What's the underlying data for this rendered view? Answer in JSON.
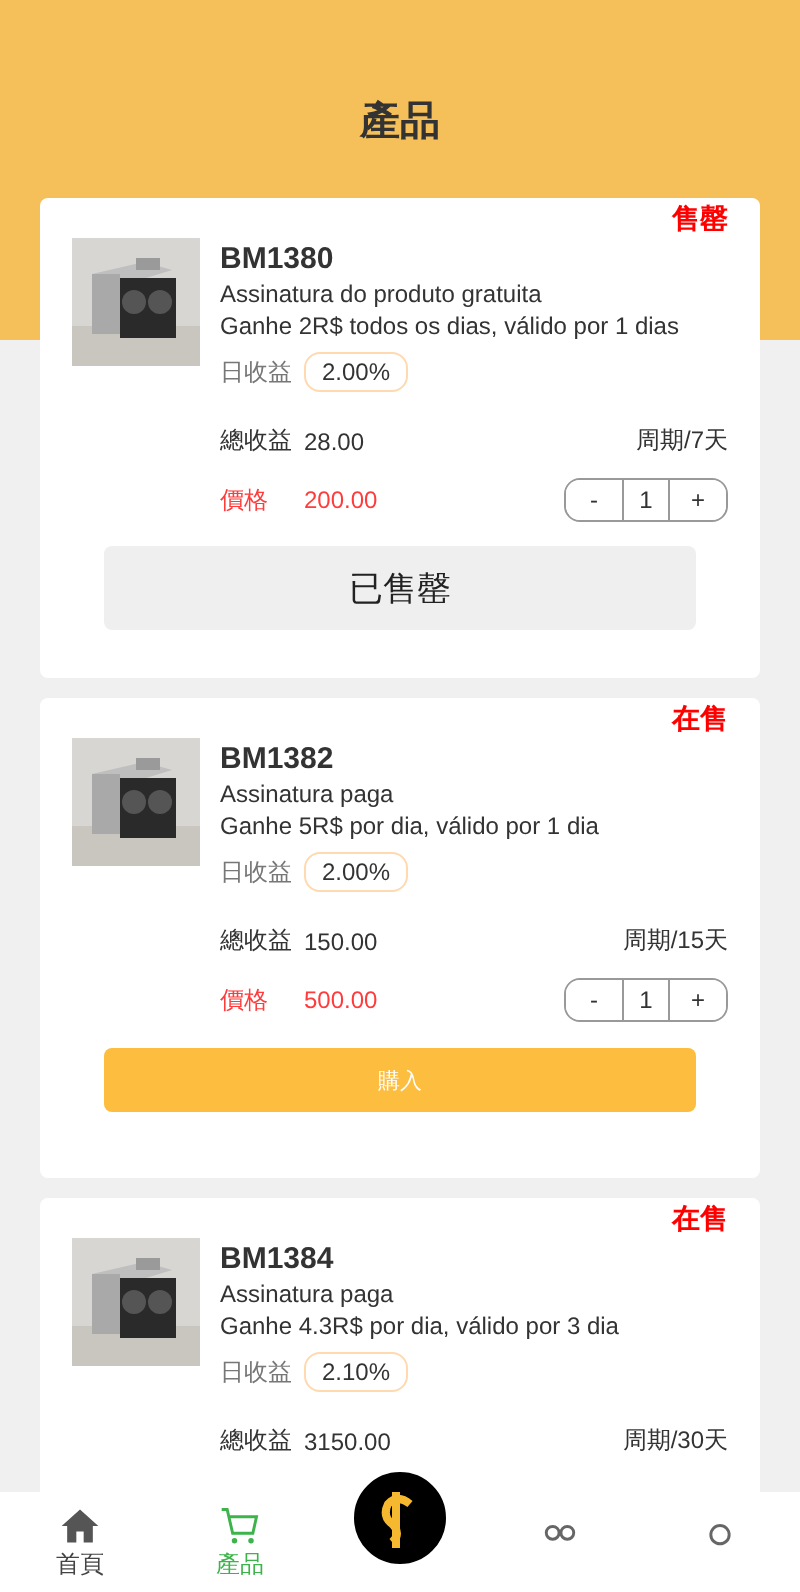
{
  "header": {
    "title": "產品"
  },
  "products": [
    {
      "status": "售罄",
      "name": "BM1380",
      "subscription": "Assinatura do produto gratuita",
      "description": "Ganhe 2R$ todos os dias, válido por 1 dias",
      "rate_label": "日收益",
      "rate": "2.00%",
      "total_label": "總收益",
      "total": "28.00",
      "period": "周期/7天",
      "price_label": "價格",
      "price": "200.00",
      "quantity": {
        "minus": "-",
        "value": "1",
        "plus": "+"
      },
      "button": {
        "kind": "sold_out",
        "label": "已售罄"
      }
    },
    {
      "status": "在售",
      "name": "BM1382",
      "subscription": "Assinatura paga",
      "description": "Ganhe 5R$ por dia, válido por 1 dia",
      "rate_label": "日收益",
      "rate": "2.00%",
      "total_label": "總收益",
      "total": "150.00",
      "period": "周期/15天",
      "price_label": "價格",
      "price": "500.00",
      "quantity": {
        "minus": "-",
        "value": "1",
        "plus": "+"
      },
      "button": {
        "kind": "buy",
        "label": "購入"
      }
    },
    {
      "status": "在售",
      "name": "BM1384",
      "subscription": "Assinatura paga",
      "description": "Ganhe 4.3R$ por dia, válido por 3 dia",
      "rate_label": "日收益",
      "rate": "2.10%",
      "total_label": "總收益",
      "total": "3150.00",
      "period": "周期/30天"
    }
  ],
  "nav": [
    {
      "kind": "home",
      "label": "首頁",
      "selected": false
    },
    {
      "kind": "cart",
      "label": "產品",
      "selected": true
    },
    {
      "kind": "coin",
      "selected": false
    },
    {
      "kind": "team",
      "selected": false
    },
    {
      "kind": "user",
      "selected": false
    }
  ]
}
